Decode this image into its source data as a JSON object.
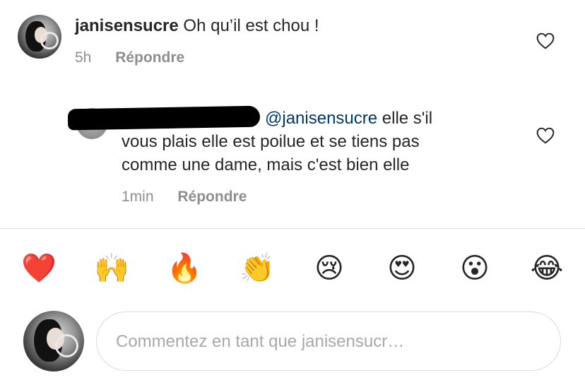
{
  "comment": {
    "username": "janisensucre",
    "text": "Oh qu’il est chou !",
    "time": "5h",
    "reply_label": "Répondre",
    "like_icon": "heart-outline-icon"
  },
  "reply": {
    "mention": "@janisensucre",
    "text_line1": " elle s'il",
    "text_line2": "vous plais elle est poilue et se tiens pas",
    "text_line3": "comme une dame, mais c'est bien elle",
    "time": "1min",
    "reply_label": "Répondre",
    "like_icon": "heart-outline-icon"
  },
  "reactions": [
    {
      "name": "red-heart-emoji",
      "glyph": "❤️"
    },
    {
      "name": "raising-hands-emoji",
      "glyph": "🙌"
    },
    {
      "name": "fire-emoji",
      "glyph": "🔥"
    },
    {
      "name": "clapping-hands-emoji",
      "glyph": "👏"
    },
    {
      "name": "crying-face-emoji",
      "glyph": "😢"
    },
    {
      "name": "heart-eyes-emoji",
      "glyph": "😍"
    },
    {
      "name": "open-mouth-face-emoji",
      "glyph": "😮"
    },
    {
      "name": "tears-of-joy-emoji",
      "glyph": "😂"
    }
  ],
  "composer": {
    "placeholder": "Commentez en tant que janisensucr…"
  },
  "colors": {
    "mention": "#00376b",
    "secondary_text": "#8e8e8e",
    "divider": "#dbdbdb"
  }
}
